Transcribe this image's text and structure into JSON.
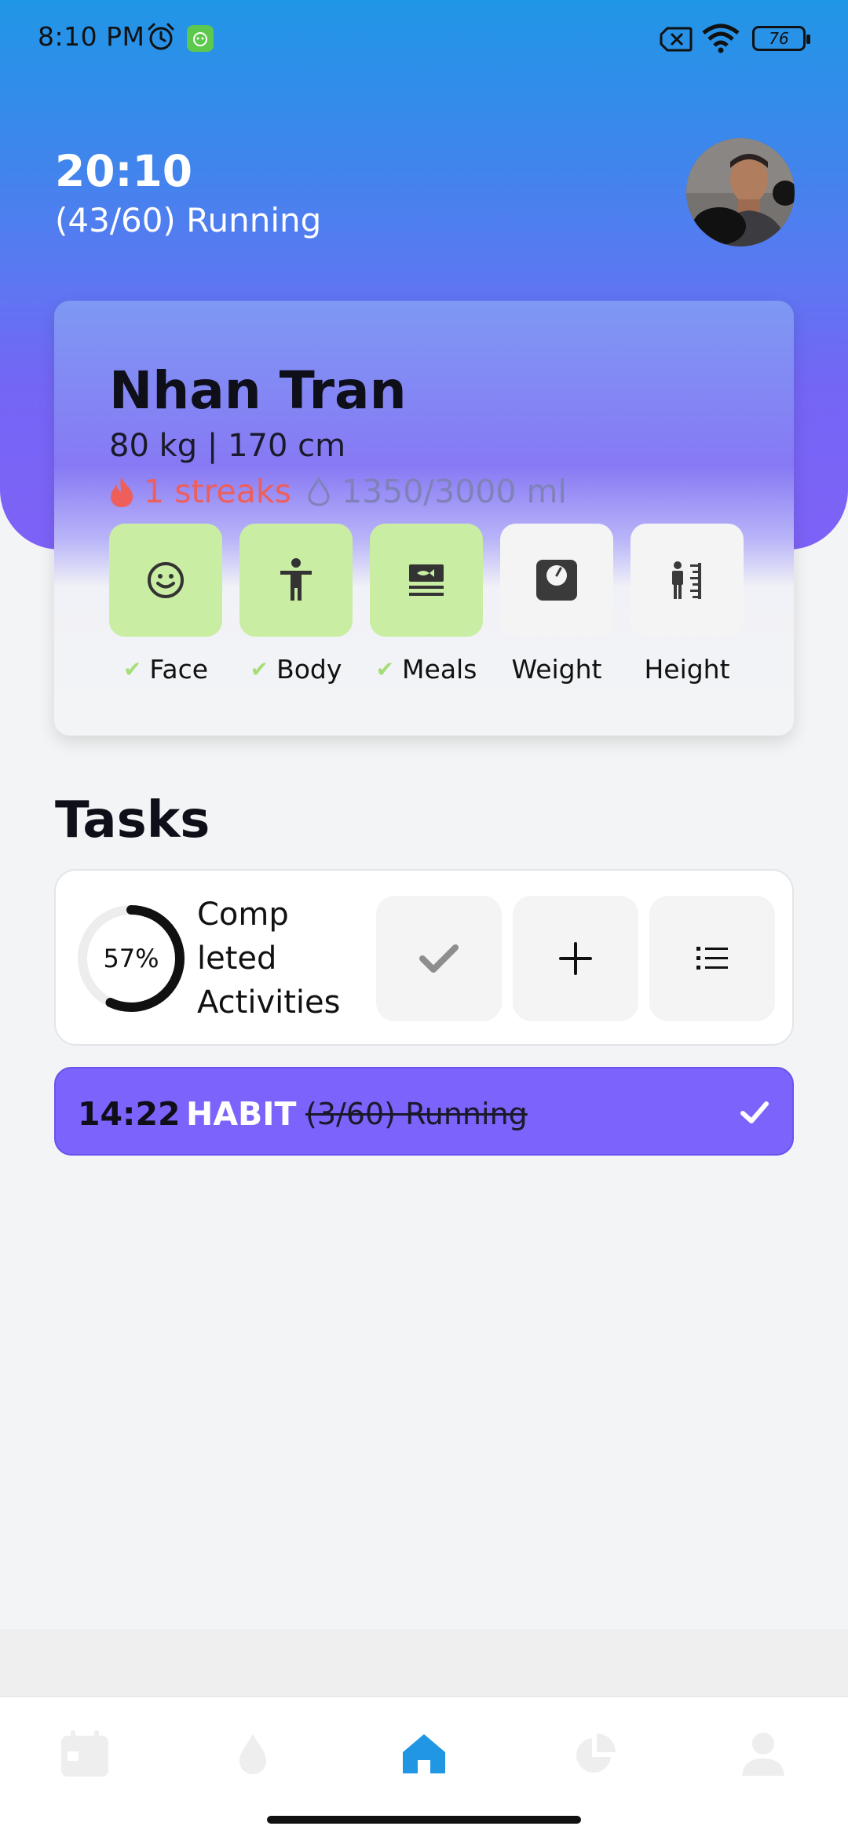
{
  "status_bar": {
    "time": "8:10 PM",
    "battery": "76",
    "icons": [
      "alarm-icon",
      "app-notification-icon",
      "no-sim-icon",
      "wifi-icon",
      "battery-icon"
    ]
  },
  "header": {
    "clock": "20:10",
    "current_activity": "(43/60) Running",
    "avatar_icon": "user-avatar-photo"
  },
  "profile": {
    "name": "Nhan Tran",
    "stats": "80 kg | 170 cm",
    "streak": "1 streaks",
    "water": "1350/3000 ml",
    "checks": [
      {
        "label": "Face",
        "done": true,
        "icon": "face-icon"
      },
      {
        "label": "Body",
        "done": true,
        "icon": "body-icon"
      },
      {
        "label": "Meals",
        "done": true,
        "icon": "meals-icon"
      },
      {
        "label": "Weight",
        "done": false,
        "icon": "scale-icon"
      },
      {
        "label": "Height",
        "done": false,
        "icon": "height-icon"
      }
    ],
    "colors": {
      "done": "#C9EDA2",
      "todo": "#F4F4F5",
      "streak": "#EE5F5B",
      "check": "#A6DE7A"
    }
  },
  "tasks": {
    "title": "Tasks",
    "progress_percent": 57,
    "progress_label": "57%",
    "completed_label": "Comp leted Activities",
    "actions": [
      "check-icon",
      "plus-icon",
      "list-icon"
    ]
  },
  "habit": {
    "time": "14:22",
    "tag": "HABIT",
    "title": "(3/60) Running",
    "color": "#7B63FC"
  },
  "nav": {
    "items": [
      "calendar-icon",
      "water-drop-icon",
      "home-icon",
      "pie-chart-icon",
      "profile-icon"
    ],
    "active_index": 2,
    "active_color": "#2196E3",
    "inactive_color": "#EEEEEE"
  }
}
